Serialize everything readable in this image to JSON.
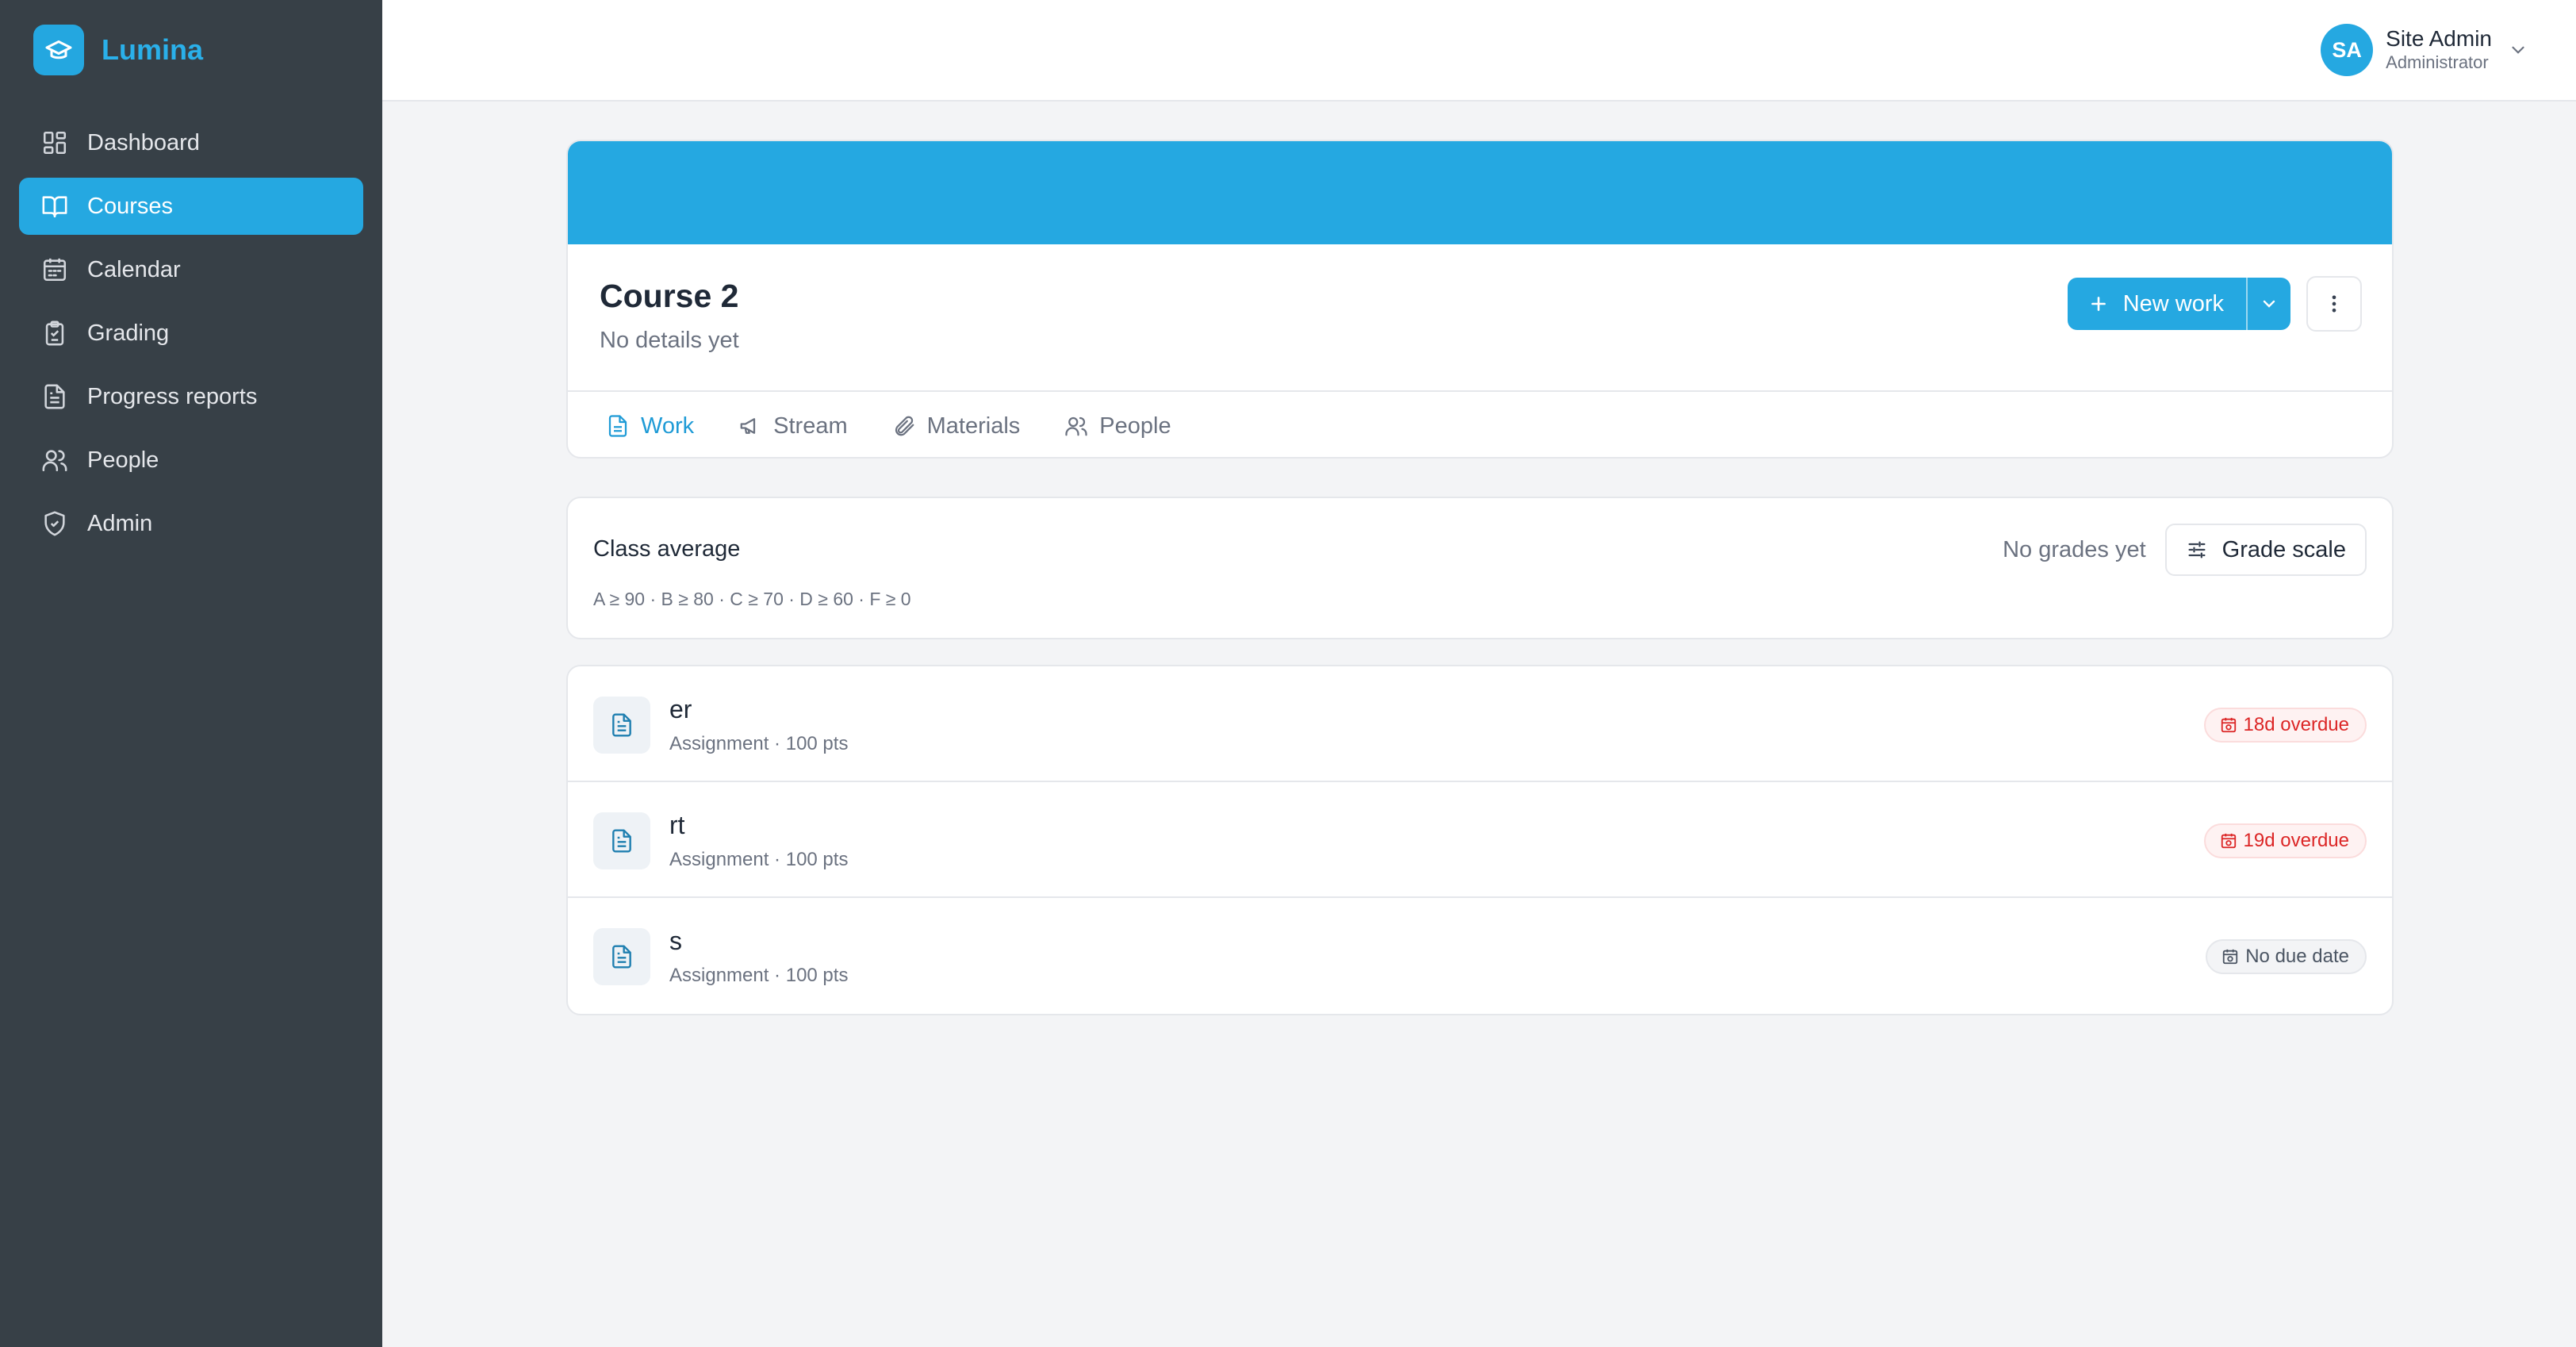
{
  "brand": {
    "name": "Lumina",
    "icon": "graduation-cap-icon",
    "color": "#2ab0ea"
  },
  "sidebar": {
    "items": [
      {
        "label": "Dashboard",
        "icon": "dashboard-icon",
        "active": false
      },
      {
        "label": "Courses",
        "icon": "book-open-icon",
        "active": true
      },
      {
        "label": "Calendar",
        "icon": "calendar-icon",
        "active": false
      },
      {
        "label": "Grading",
        "icon": "clipboard-icon",
        "active": false
      },
      {
        "label": "Progress reports",
        "icon": "file-text-icon",
        "active": false
      },
      {
        "label": "People",
        "icon": "users-icon",
        "active": false
      },
      {
        "label": "Admin",
        "icon": "shield-check-icon",
        "active": false
      }
    ]
  },
  "user": {
    "initials": "SA",
    "name": "Site Admin",
    "role": "Administrator"
  },
  "course": {
    "title": "Course 2",
    "subtitle": "No details yet",
    "banner_color": "#25a8e1",
    "new_work_label": "New work",
    "tabs": [
      {
        "label": "Work",
        "icon": "file-text-icon",
        "active": true
      },
      {
        "label": "Stream",
        "icon": "megaphone-icon",
        "active": false
      },
      {
        "label": "Materials",
        "icon": "paperclip-icon",
        "active": false
      },
      {
        "label": "People",
        "icon": "users-icon",
        "active": false
      }
    ]
  },
  "class_average": {
    "title": "Class average",
    "scale_text": "A ≥ 90 · B ≥ 80 · C ≥ 70 · D ≥ 60 · F ≥ 0",
    "status": "No grades yet",
    "grade_scale_label": "Grade scale"
  },
  "work_items": [
    {
      "title": "er",
      "meta": "Assignment · 100 pts",
      "due": "18d overdue",
      "due_status": "overdue"
    },
    {
      "title": "rt",
      "meta": "Assignment · 100 pts",
      "due": "19d overdue",
      "due_status": "overdue"
    },
    {
      "title": "s",
      "meta": "Assignment · 100 pts",
      "due": "No due date",
      "due_status": "none"
    }
  ],
  "colors": {
    "accent": "#25a8e1",
    "sidebar_bg": "#374047",
    "danger": "#dc2626"
  }
}
